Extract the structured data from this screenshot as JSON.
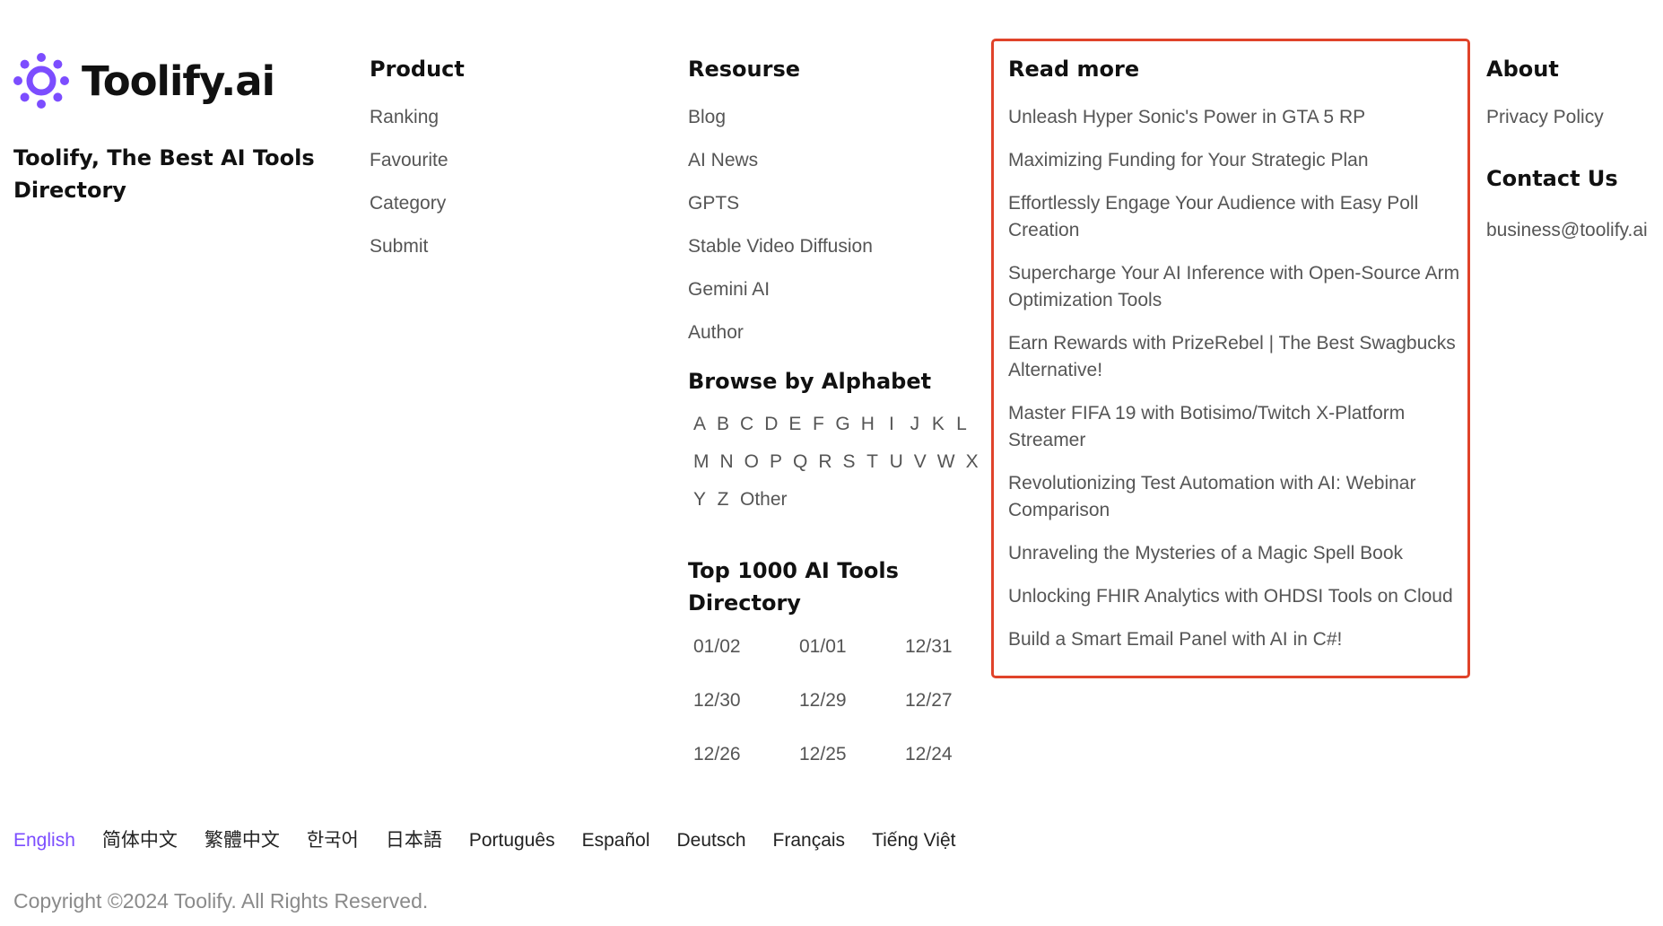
{
  "brand": {
    "name": "Toolify.ai",
    "tagline": "Toolify, The Best AI Tools Directory",
    "accent_color": "#7c4dff"
  },
  "product": {
    "title": "Product",
    "links": [
      "Ranking",
      "Favourite",
      "Category",
      "Submit"
    ]
  },
  "resource": {
    "title": "Resourse",
    "links": [
      "Blog",
      "AI News",
      "GPTS",
      "Stable Video Diffusion",
      "Gemini AI",
      "Author"
    ]
  },
  "alphabet": {
    "title": "Browse by Alphabet",
    "letters": [
      "A",
      "B",
      "C",
      "D",
      "E",
      "F",
      "G",
      "H",
      "I",
      "J",
      "K",
      "L",
      "M",
      "N",
      "O",
      "P",
      "Q",
      "R",
      "S",
      "T",
      "U",
      "V",
      "W",
      "X",
      "Y",
      "Z",
      "Other"
    ]
  },
  "top1000": {
    "title": "Top 1000 AI Tools Directory",
    "dates": [
      "01/02",
      "01/01",
      "12/31",
      "12/30",
      "12/29",
      "12/27",
      "12/26",
      "12/25",
      "12/24"
    ]
  },
  "readmore": {
    "title": "Read more",
    "highlight_color": "#e0432a",
    "links": [
      "Unleash Hyper Sonic's Power in GTA 5 RP",
      "Maximizing Funding for Your Strategic Plan",
      "Effortlessly Engage Your Audience with Easy Poll Creation",
      "Supercharge Your AI Inference with Open-Source Arm Optimization Tools",
      "Earn Rewards with PrizeRebel | The Best Swagbucks Alternative!",
      "Master FIFA 19 with Botisimo/Twitch X-Platform Streamer",
      "Revolutionizing Test Automation with AI: Webinar Comparison",
      "Unraveling the Mysteries of a Magic Spell Book",
      "Unlocking FHIR Analytics with OHDSI Tools on Cloud",
      "Build a Smart Email Panel with AI in C#!"
    ]
  },
  "about": {
    "title": "About",
    "links": [
      "Privacy Policy"
    ],
    "contact_title": "Contact Us",
    "contact_email": "business@toolify.ai"
  },
  "languages": {
    "active": "English",
    "items": [
      "English",
      "简体中文",
      "繁體中文",
      "한국어",
      "日本語",
      "Português",
      "Español",
      "Deutsch",
      "Français",
      "Tiếng Việt"
    ]
  },
  "copyright": "Copyright ©2024 Toolify. All Rights Reserved."
}
